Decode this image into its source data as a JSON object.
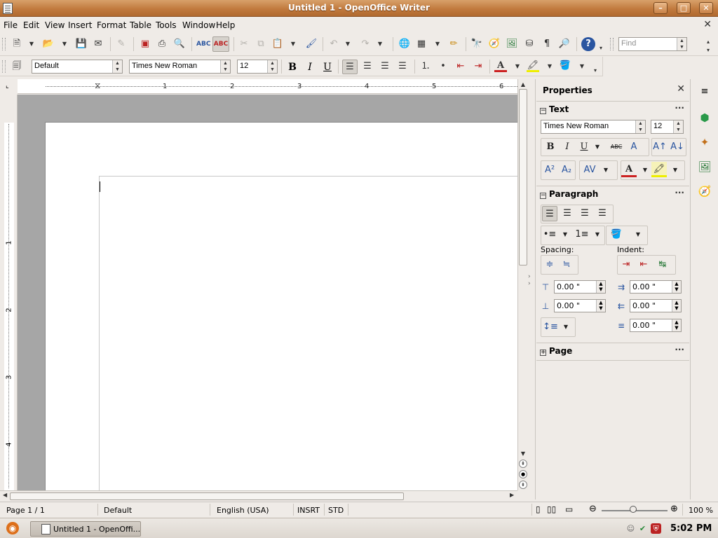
{
  "window": {
    "title": "Untitled 1 - OpenOffice Writer",
    "buttons": {
      "minimize": "–",
      "maximize": "□",
      "close": "✕"
    }
  },
  "menu": {
    "items": [
      "File",
      "Edit",
      "View",
      "Insert",
      "Format",
      "Table",
      "Tools",
      "Window",
      "Help"
    ],
    "close_glyph": "✕"
  },
  "standard_toolbar": {
    "icons": [
      "new-document",
      "open",
      "save",
      "email",
      "edit-file",
      "export-pdf",
      "print",
      "print-preview",
      "spellcheck",
      "autospellcheck",
      "cut",
      "copy",
      "paste",
      "clone-formatting",
      "undo",
      "redo",
      "hyperlink",
      "table",
      "show-draw",
      "find-replace",
      "navigator",
      "gallery",
      "data-sources",
      "formatting-marks",
      "zoom",
      "help"
    ],
    "find": {
      "placeholder": "Find"
    }
  },
  "formatting_toolbar": {
    "paragraph_style": "Default",
    "font_name": "Times New Roman",
    "font_size": "12",
    "bold": "B",
    "italic": "I",
    "underline": "U",
    "alignment_active": "left"
  },
  "ruler": {
    "horizontal_numbers": [
      "1",
      "2",
      "3",
      "4",
      "5",
      "6"
    ],
    "vertical_numbers": [
      "1",
      "2",
      "3",
      "4"
    ]
  },
  "properties": {
    "title": "Properties",
    "close_glyph": "✕",
    "sections": {
      "text": {
        "title": "Text",
        "font_name": "Times New Roman",
        "font_size": "12"
      },
      "paragraph": {
        "title": "Paragraph",
        "spacing_label": "Spacing:",
        "indent_label": "Indent:",
        "above_spacing": "0.00 \"",
        "below_spacing": "0.00 \"",
        "before_indent": "0.00 \"",
        "after_indent": "0.00 \"",
        "first_line_indent": "0.00 \""
      },
      "page": {
        "title": "Page"
      }
    },
    "more_glyph": "···"
  },
  "statusbar": {
    "page": "Page 1 / 1",
    "page_style": "Default",
    "language": "English (USA)",
    "insert_mode": "INSRT",
    "selection_mode": "STD",
    "zoom": "100 %"
  },
  "taskbar": {
    "task_label": "Untitled 1 - OpenOffi...",
    "clock": "5:02 PM"
  },
  "colors": {
    "titlebar": "#c17a3e",
    "ubuntu_orange": "#dd6f1a",
    "document_background": "#a6a6a6",
    "chrome": "#efebe7"
  }
}
